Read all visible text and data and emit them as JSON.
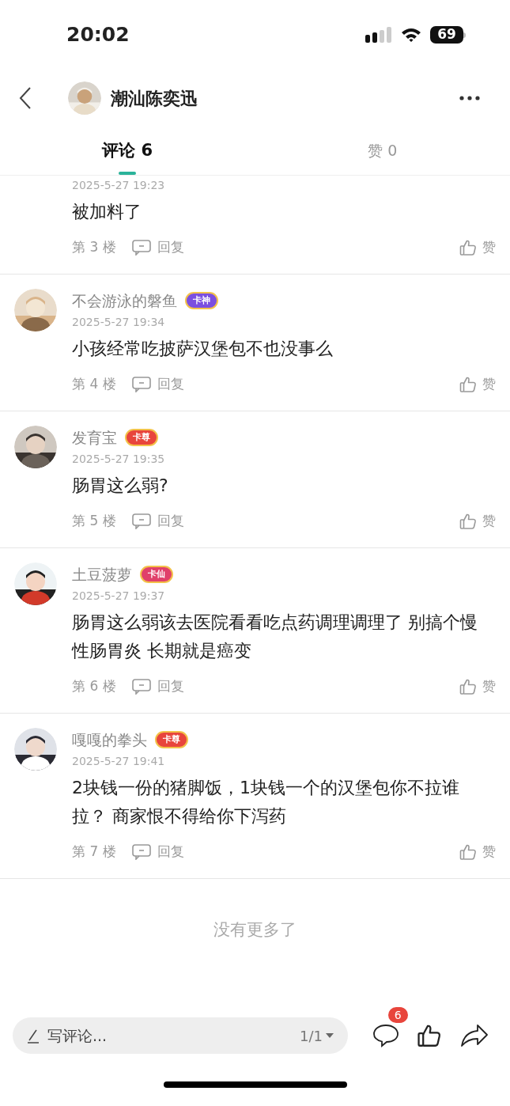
{
  "status_bar": {
    "time": "20:02",
    "battery": "69"
  },
  "header": {
    "title": "潮汕陈奕迅"
  },
  "tabs": [
    {
      "label": "评论 6",
      "selected": true
    },
    {
      "label": "赞 0",
      "selected": false
    }
  ],
  "comments": [
    {
      "date": "2025-5-27 19:23",
      "text": "被加料了",
      "floor": "第 3 楼",
      "reply": "回复",
      "like": "赞"
    },
    {
      "name": "不会游泳的磐鱼",
      "badge": {
        "label": "卡神",
        "color": "#7b4fe0"
      },
      "date": "2025-5-27 19:34",
      "text": "小孩经常吃披萨汉堡包不也没事么",
      "floor": "第 4 楼",
      "reply": "回复",
      "like": "赞"
    },
    {
      "name": "发育宝",
      "badge": {
        "label": "卡尊",
        "color": "#e8453c"
      },
      "date": "2025-5-27 19:35",
      "text": "肠胃这么弱?",
      "floor": "第 5 楼",
      "reply": "回复",
      "like": "赞"
    },
    {
      "name": "土豆菠萝",
      "badge": {
        "label": "卡仙",
        "color": "#e0406a"
      },
      "date": "2025-5-27 19:37",
      "text": "肠胃这么弱该去医院看看吃点药调理调理了 别搞个慢性肠胃炎 长期就是癌变",
      "floor": "第 6 楼",
      "reply": "回复",
      "like": "赞"
    },
    {
      "name": "嘎嘎的拳头",
      "badge": {
        "label": "卡尊",
        "color": "#e8453c"
      },
      "date": "2025-5-27 19:41",
      "text": "2块钱一份的猪脚饭，1块钱一个的汉堡包你不拉谁拉？ 商家恨不得给你下泻药",
      "floor": "第 7 楼",
      "reply": "回复",
      "like": "赞"
    }
  ],
  "end_note": "没有更多了",
  "bottom_bar": {
    "placeholder": "写评论...",
    "page": "1/1",
    "comment_count": "6"
  }
}
